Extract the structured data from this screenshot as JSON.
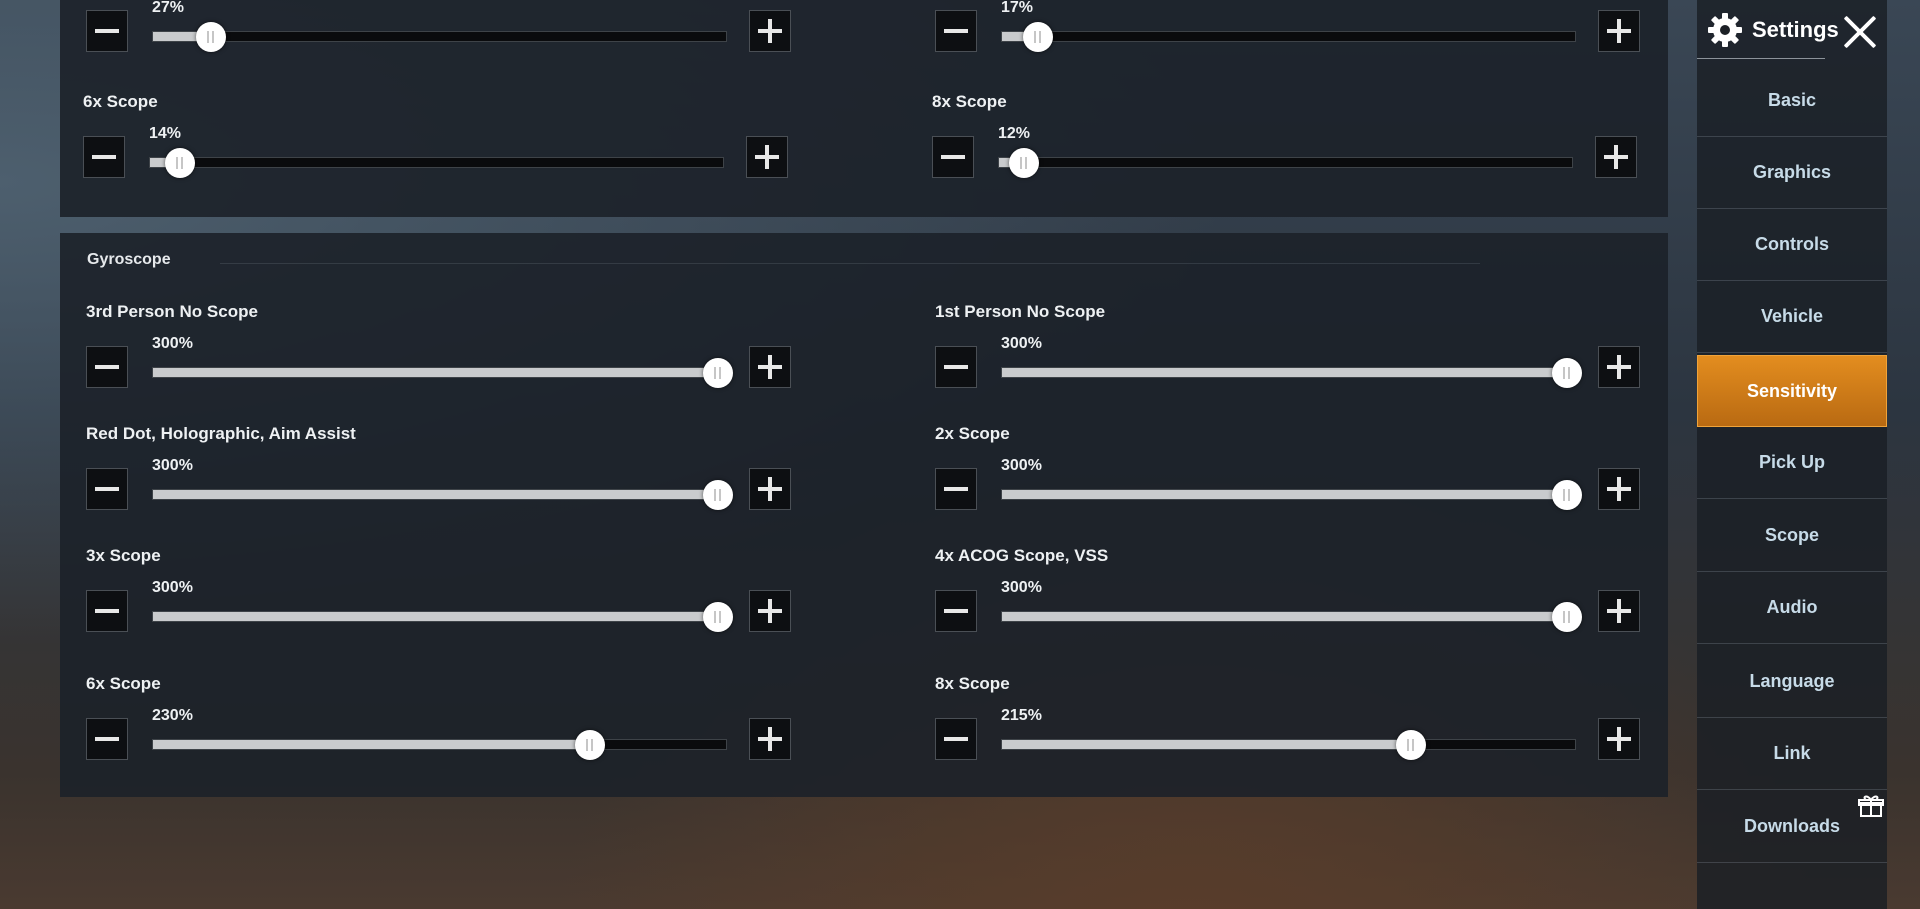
{
  "sidebar": {
    "title": "Settings",
    "items": [
      {
        "label": "Basic"
      },
      {
        "label": "Graphics"
      },
      {
        "label": "Controls"
      },
      {
        "label": "Vehicle"
      },
      {
        "label": "Sensitivity",
        "active": true
      },
      {
        "label": "Pick Up"
      },
      {
        "label": "Scope"
      },
      {
        "label": "Audio"
      },
      {
        "label": "Language"
      },
      {
        "label": "Link"
      },
      {
        "label": "Downloads"
      }
    ],
    "icons": {
      "settings": "gear-icon",
      "close": "close-icon",
      "gift": "gift-icon"
    },
    "active_color": "#e38d1f"
  },
  "top_section": {
    "rows": [
      {
        "left": {
          "label": "",
          "value_text": "27%",
          "level": 0.09
        },
        "right": {
          "label": "",
          "value_text": "17%",
          "level": 0.05
        }
      },
      {
        "left": {
          "label": "6x Scope",
          "value_text": "14%",
          "level": 0.04
        },
        "right": {
          "label": "8x Scope",
          "value_text": "12%",
          "level": 0.03
        }
      }
    ]
  },
  "gyroscope": {
    "title": "Gyroscope",
    "rows": [
      {
        "left": {
          "label": "3rd Person No Scope",
          "value_text": "300%",
          "level": 1.0
        },
        "right": {
          "label": "1st Person No Scope",
          "value_text": "300%",
          "level": 1.0
        }
      },
      {
        "left": {
          "label": "Red Dot, Holographic, Aim Assist",
          "value_text": "300%",
          "level": 1.0
        },
        "right": {
          "label": "2x Scope",
          "value_text": "300%",
          "level": 1.0
        }
      },
      {
        "left": {
          "label": "3x Scope",
          "value_text": "300%",
          "level": 1.0
        },
        "right": {
          "label": "4x ACOG Scope, VSS",
          "value_text": "300%",
          "level": 1.0
        }
      },
      {
        "left": {
          "label": "6x Scope",
          "value_text": "230%",
          "level": 0.77
        },
        "right": {
          "label": "8x Scope",
          "value_text": "215%",
          "level": 0.72
        }
      }
    ]
  }
}
